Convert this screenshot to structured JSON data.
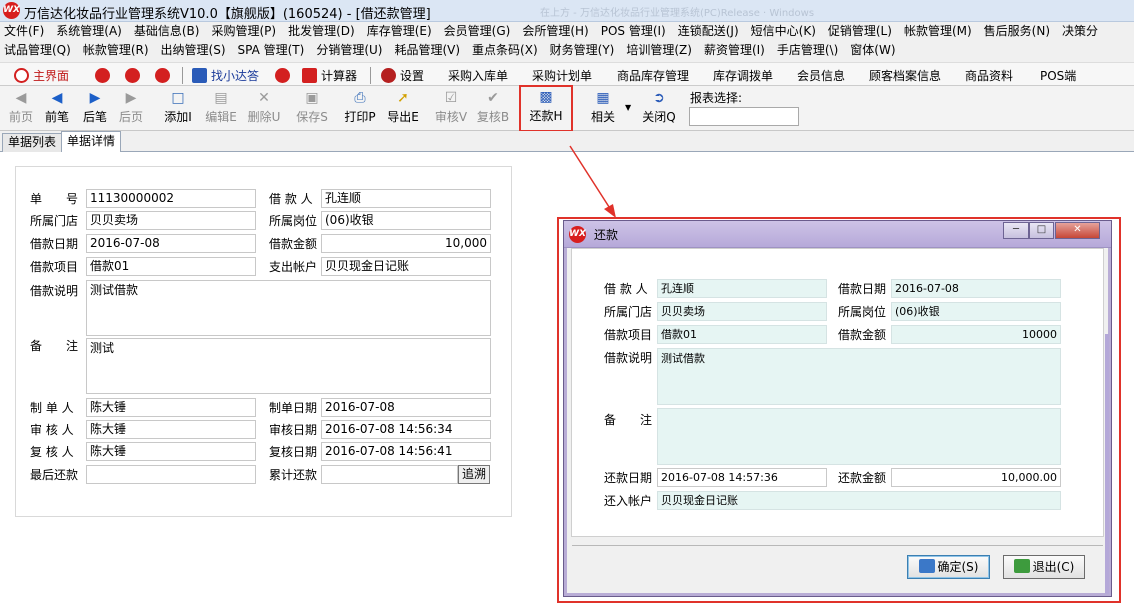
{
  "window": {
    "title": "万信达化妆品行业管理系统V10.0【旗舰版】(160524) - [借还款管理]",
    "ghost_text": "在上方 - 万信达化妆品行业管理系统(PC)Release · Windows",
    "logo_text": "WX"
  },
  "menu": {
    "row1": [
      "文件(F)",
      "系统管理(A)",
      "基础信息(B)",
      "采购管理(P)",
      "批发管理(D)",
      "库存管理(E)",
      "会员管理(G)",
      "会所管理(H)",
      "POS 管理(I)",
      "连锁配送(J)",
      "短信中心(K)",
      "促销管理(L)",
      "帐款管理(M)",
      "售后服务(N)",
      "决策分"
    ],
    "row2": [
      "试品管理(Q)",
      "帐款管理(R)",
      "出纳管理(S)",
      "SPA 管理(T)",
      "分销管理(U)",
      "耗品管理(V)",
      "重点条码(X)",
      "财务管理(Y)",
      "培训管理(Z)",
      "薪资管理(I)",
      "手店管理(\\)",
      "窗体(W)"
    ]
  },
  "quickbar": {
    "home": "主界面",
    "find": "找小达答",
    "calc": "计算器",
    "settings": "设置",
    "links": [
      "采购入库单",
      "采购计划单",
      "商品库存管理",
      "库存调拨单",
      "会员信息",
      "顾客档案信息",
      "商品资料",
      "POS端"
    ]
  },
  "toolbar": {
    "prev_page": "前页",
    "prev": "前笔",
    "next": "后笔",
    "next_page": "后页",
    "add": "添加I",
    "edit": "编辑E",
    "delete": "删除U",
    "save": "保存S",
    "print": "打印P",
    "export": "导出E",
    "audit": "审核V",
    "reaudit": "复核B",
    "repay": "还款H",
    "related": "相关",
    "close": "关闭Q",
    "report_label": "报表选择:",
    "report_value": ""
  },
  "tabs": [
    "单据列表",
    "单据详情"
  ],
  "form": {
    "doc_no_label": "单　　号",
    "doc_no": "11130000002",
    "borrower_label": "借 款 人",
    "borrower": "孔连顺",
    "store_label": "所属门店",
    "store": "贝贝卖场",
    "post_label": "所属岗位",
    "post": "(06)收银",
    "date_label": "借款日期",
    "date": "2016-07-08",
    "amount_label": "借款金额",
    "amount": "10,000",
    "item_label": "借款项目",
    "item": "借款01",
    "account_label": "支出帐户",
    "account": "贝贝现金日记账",
    "desc_label": "借款说明",
    "desc": "测试借款",
    "note_label": "备　　注",
    "note": "测试",
    "maker_label": "制 单 人",
    "maker": "陈大锤",
    "make_date_label": "制单日期",
    "make_date": "2016-07-08",
    "auditor_label": "审 核 人",
    "auditor": "陈大锤",
    "audit_date_label": "审核日期",
    "audit_date": "2016-07-08  14:56:34",
    "reviewer_label": "复 核 人",
    "reviewer": "陈大锤",
    "review_date_label": "复核日期",
    "review_date": "2016-07-08  14:56:41",
    "last_repay_label": "最后还款",
    "last_repay": "",
    "total_repay_label": "累计还款",
    "total_repay": "",
    "trace_button": "追溯"
  },
  "dialog": {
    "title": "还款",
    "borrower_label": "借 款 人",
    "borrower": "孔连顺",
    "date_label": "借款日期",
    "date": "2016-07-08",
    "store_label": "所属门店",
    "store": "贝贝卖场",
    "post_label": "所属岗位",
    "post": "(06)收银",
    "item_label": "借款项目",
    "item": "借款01",
    "amount_label": "借款金额",
    "amount": "10000",
    "desc_label": "借款说明",
    "desc": "测试借款",
    "note_label": "备　　注",
    "note": "",
    "repay_date_label": "还款日期",
    "repay_date": "2016-07-08  14:57:36",
    "repay_amount_label": "还款金额",
    "repay_amount": "10,000.00",
    "account_label": "还入帐户",
    "account": "贝贝现金日记账",
    "ok_button": "确定(S)",
    "exit_button": "退出(C)"
  },
  "colors": {
    "highlight": "#e0322a",
    "dialog_title": "#b6a9d9",
    "dialog_field": "#e6f5f3",
    "logo": "#d81e1e"
  }
}
